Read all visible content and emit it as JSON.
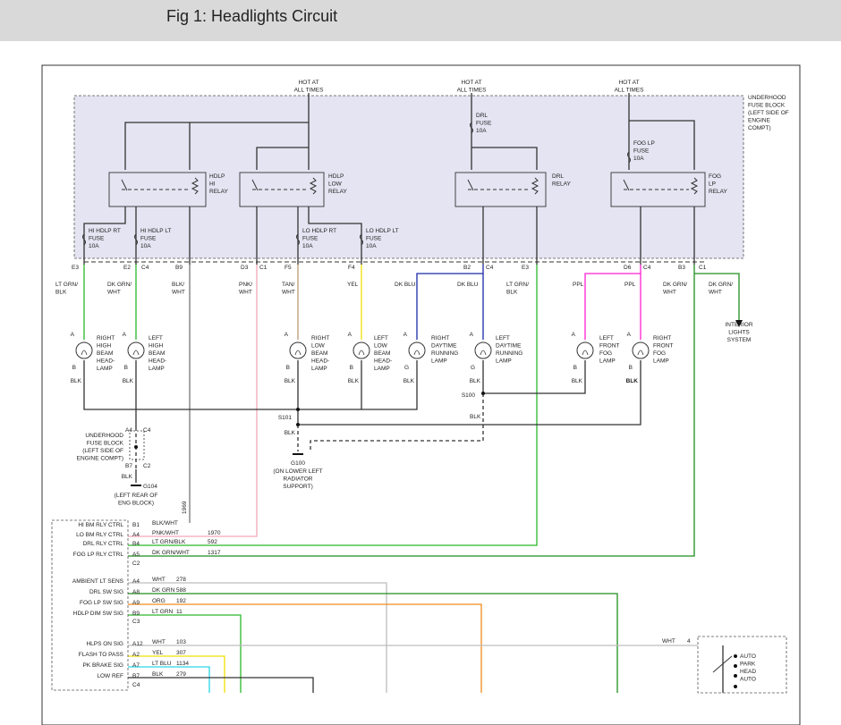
{
  "title": "Fig 1: Headlights Circuit",
  "colors": {
    "fuse_block_bg": "#e4e4f2",
    "lt_grn": "#2ab82a",
    "pnk": "#f4a6b8",
    "tan": "#b89a72",
    "yel": "#f0e000",
    "dk_blu": "#1a2aa8",
    "ppl": "#ff1fd0",
    "dk_grn": "#1f8f1f",
    "wht": "#bdbdbd",
    "org": "#f08a1c",
    "lt_blu": "#2ad6e6",
    "blk": "#333333"
  },
  "labels": {
    "hot1": [
      "HOT AT",
      "ALL TIMES"
    ],
    "hot2": [
      "HOT AT",
      "ALL TIMES"
    ],
    "hot3": [
      "HOT AT",
      "ALL TIMES"
    ],
    "fuse_block": [
      "UNDERHOOD",
      "FUSE BLOCK",
      "(LEFT SIDE OF",
      "ENGINE",
      "COMPT)"
    ],
    "drl_fuse": [
      "DRL",
      "FUSE",
      "10A"
    ],
    "fog_fuse": [
      "FOG LP",
      "FUSE",
      "10A"
    ],
    "hdlp_hi_relay": [
      "HDLP",
      "HI",
      "RELAY"
    ],
    "hdlp_low_relay": [
      "HDLP",
      "LOW",
      "RELAY"
    ],
    "drl_relay": [
      "DRL",
      "RELAY"
    ],
    "fog_relay": [
      "FOG",
      "LP",
      "RELAY"
    ],
    "hi_rt_fuse": [
      "HI HDLP RT",
      "FUSE",
      "10A"
    ],
    "hi_lt_fuse": [
      "HI HDLP LT",
      "FUSE",
      "10A"
    ],
    "lo_rt_fuse": [
      "LO HDLP RT",
      "FUSE",
      "10A"
    ],
    "lo_lt_fuse": [
      "LO HDLP LT",
      "FUSE",
      "10A"
    ],
    "connectors": [
      "E3",
      "E2",
      "C4",
      "B9",
      "D3",
      "C1",
      "F5",
      "F4",
      "B2",
      "C4",
      "E3",
      "D6",
      "C4",
      "B3",
      "C1"
    ],
    "wires": [
      [
        "LT GRN/",
        "BLK"
      ],
      [
        "DK GRN/",
        "WHT"
      ],
      [
        "BLK/",
        "WHT"
      ],
      [
        "PNK/",
        "WHT"
      ],
      [
        "TAN/",
        "WHT"
      ],
      [
        "YEL"
      ],
      [
        "DK BLU"
      ],
      [
        "DK BLU"
      ],
      [
        "LT GRN/",
        "BLK"
      ],
      [
        "PPL"
      ],
      [
        "PPL"
      ],
      [
        "DK GRN/",
        "WHT"
      ],
      [
        "DK GRN/",
        "WHT"
      ]
    ],
    "interior": [
      "INTERIOR",
      "LIGHTS",
      "SYSTEM"
    ],
    "lamps": [
      [
        "RIGHT",
        "HIGH",
        "BEAM",
        "HEAD-",
        "LAMP"
      ],
      [
        "LEFT",
        "HIGH",
        "BEAM",
        "HEAD-",
        "LAMP"
      ],
      [
        "RIGHT",
        "LOW",
        "BEAM",
        "HEAD-",
        "LAMP"
      ],
      [
        "LEFT",
        "LOW",
        "BEAM",
        "HEAD-",
        "LAMP"
      ],
      [
        "RIGHT",
        "DAYTIME",
        "RUNNING",
        "LAMP"
      ],
      [
        "LEFT",
        "DAYTIME",
        "RUNNING",
        "LAMP"
      ],
      [
        "LEFT",
        "FRONT",
        "FOG",
        "LAMP"
      ],
      [
        "RIGHT",
        "FRONT",
        "FOG",
        "LAMP"
      ]
    ],
    "pin_a": "A",
    "pin_b": "B",
    "pin_g": "G",
    "blk": "BLK",
    "s100": "S100",
    "s101": "S101",
    "uh_fuse_block2": [
      "UNDERHOOD",
      "FUSE BLOCK",
      "(LEFT SIDE OF",
      "ENGINE COMPT)"
    ],
    "a4": "A4",
    "c4b": "C4",
    "b7": "B7",
    "c2": "C2",
    "g104": "G104",
    "g104_desc": [
      "(LEFT REAR OF",
      "ENG BLOCK)"
    ],
    "g100": "G100",
    "g100_desc": [
      "(ON LOWER LEFT",
      "RADIATOR",
      "SUPPORT)"
    ],
    "n1969": "1969",
    "module_rows": [
      {
        "label": "HI BM RLY CTRL",
        "pin": "B1",
        "wire": "BLK/WHT",
        "num": ""
      },
      {
        "label": "LO BM RLY CTRL",
        "pin": "A4",
        "wire": "PNK/WHT",
        "num": "1970"
      },
      {
        "label": "DRL RLY CTRL",
        "pin": "B4",
        "wire": "LT GRN/BLK",
        "num": "592"
      },
      {
        "label": "FOG LP RLY CTRL",
        "pin": "A5",
        "wire": "DK GRN/WHT",
        "num": "1317"
      },
      {
        "label": "",
        "pin": "C2",
        "wire": "",
        "num": ""
      },
      {
        "label": "AMBIENT LT SENS",
        "pin": "A4",
        "wire": "WHT",
        "num": "278"
      },
      {
        "label": "DRL SW SIG",
        "pin": "A8",
        "wire": "DK GRN",
        "num": "588"
      },
      {
        "label": "FOG LP SW SIG",
        "pin": "A9",
        "wire": "ORG",
        "num": "192"
      },
      {
        "label": "HDLP DIM SW SIG",
        "pin": "B9",
        "wire": "LT GRN",
        "num": "11"
      },
      {
        "label": "",
        "pin": "C3",
        "wire": "",
        "num": ""
      },
      {
        "label": "HLPS ON SIG",
        "pin": "A12",
        "wire": "WHT",
        "num": "103"
      },
      {
        "label": "FLASH TO PASS",
        "pin": "A2",
        "wire": "YEL",
        "num": "307"
      },
      {
        "label": "PK BRAKE SIG",
        "pin": "A7",
        "wire": "LT BLU",
        "num": "1134"
      },
      {
        "label": "LOW REF",
        "pin": "B7",
        "wire": "BLK",
        "num": "279"
      },
      {
        "label": "",
        "pin": "C4",
        "wire": "",
        "num": ""
      }
    ],
    "switch_wht": "WHT",
    "switch_pin": "4",
    "switch_opts": [
      "AUTO",
      "PARK",
      "HEAD",
      "AUTO"
    ]
  }
}
